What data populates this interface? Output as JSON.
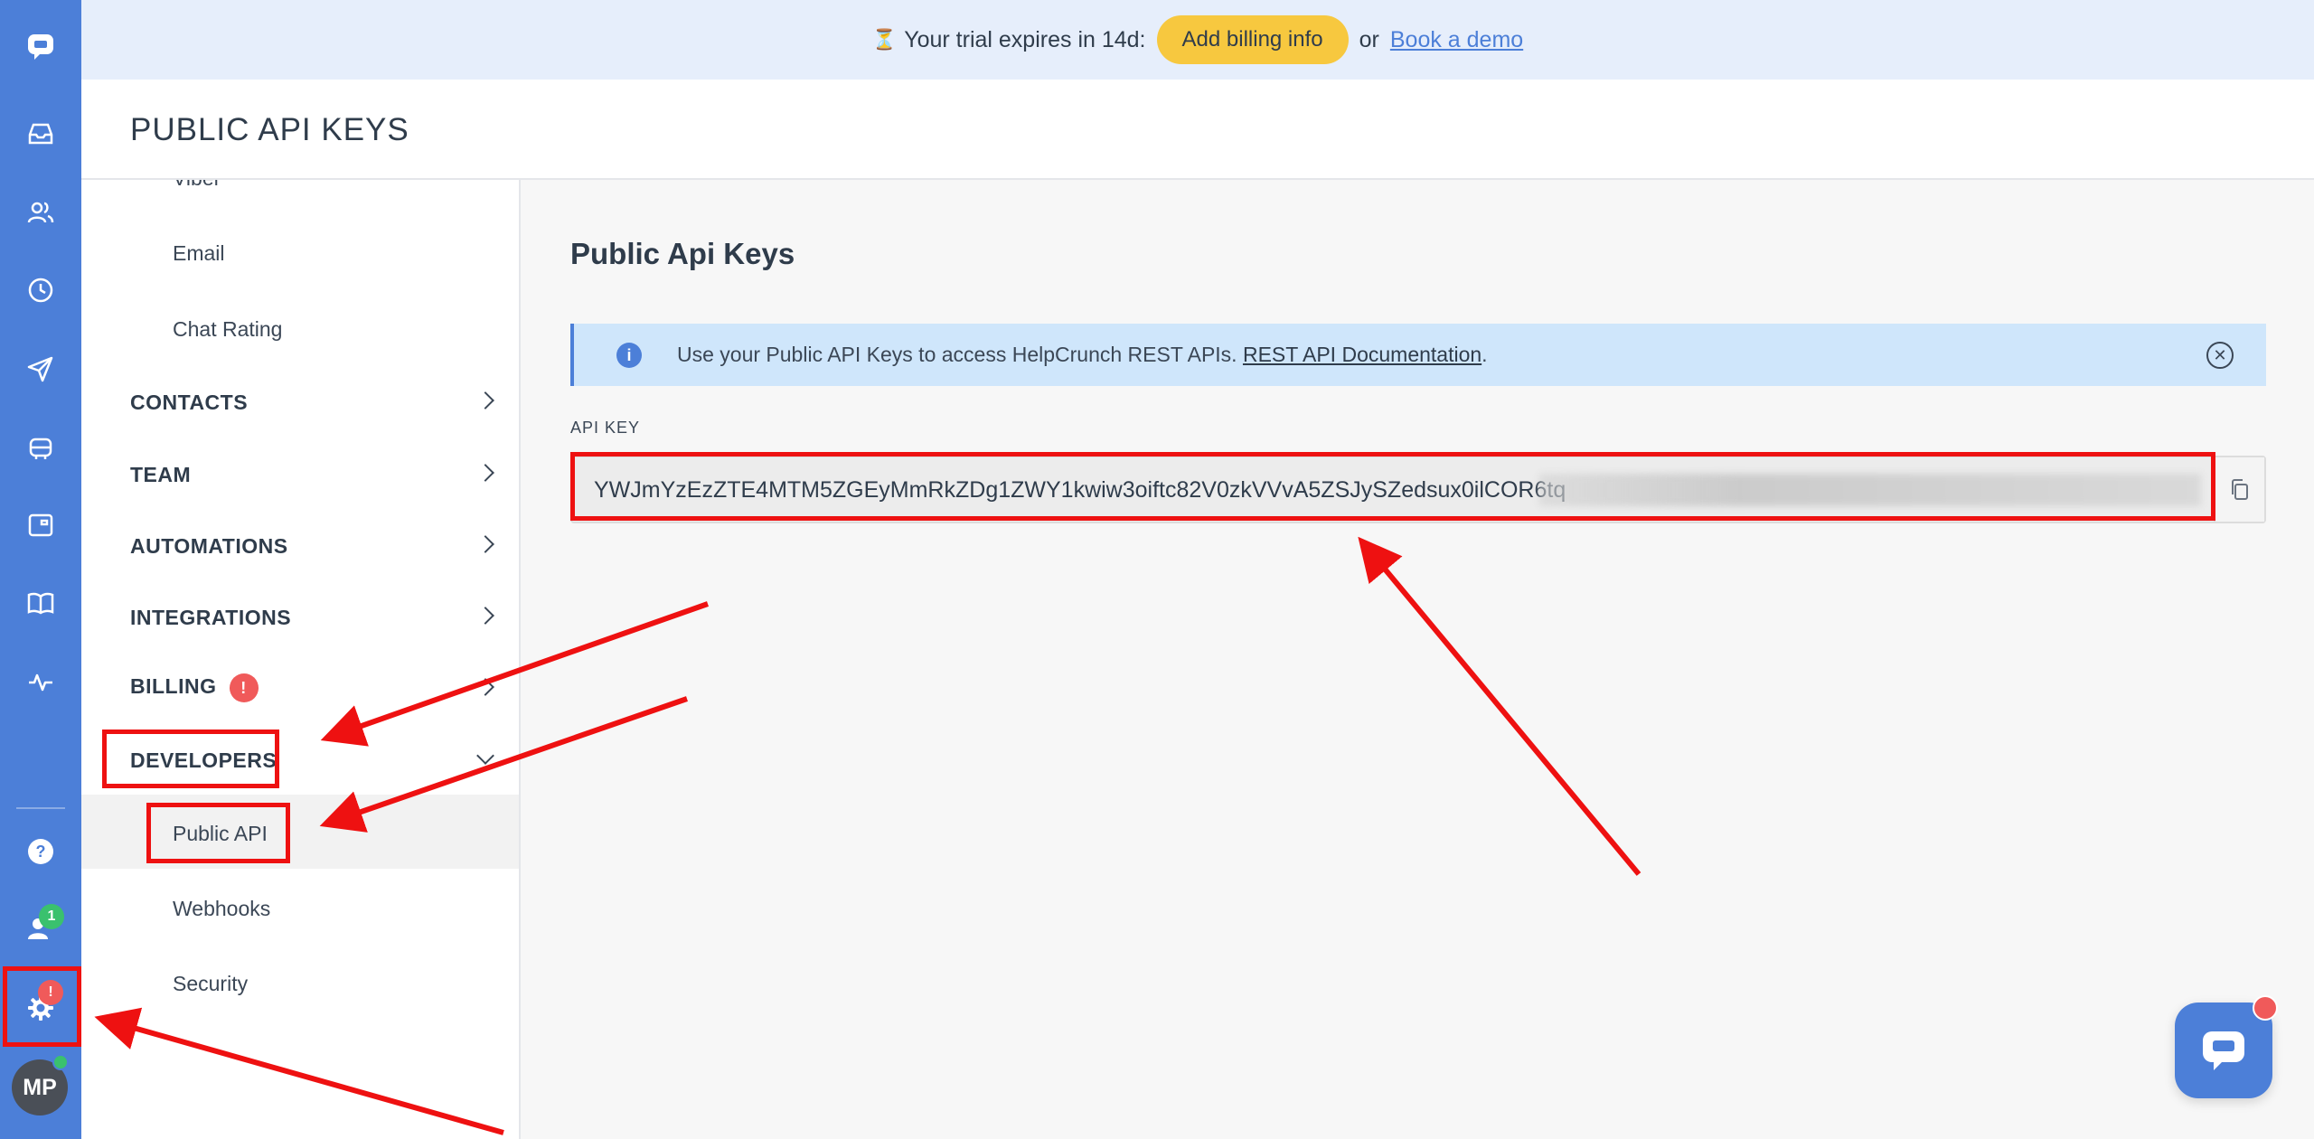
{
  "trial_bar": {
    "prefix": "Your trial expires in 14d:",
    "billing_button": "Add billing info",
    "or_text": "or",
    "demo_link": "Book a demo"
  },
  "page_title": "PUBLIC API KEYS",
  "settings_nav": {
    "sub_items_top": [
      "Viber",
      "Email",
      "Chat Rating"
    ],
    "sections": [
      {
        "label": "CONTACTS",
        "expanded": false
      },
      {
        "label": "TEAM",
        "expanded": false
      },
      {
        "label": "AUTOMATIONS",
        "expanded": false
      },
      {
        "label": "INTEGRATIONS",
        "expanded": false
      },
      {
        "label": "BILLING",
        "badge": "!",
        "expanded": false
      },
      {
        "label": "DEVELOPERS",
        "expanded": true
      }
    ],
    "developer_items": [
      "Public API",
      "Webhooks",
      "Security"
    ],
    "active_item": "Public API"
  },
  "content": {
    "title": "Public Api Keys",
    "info_text": "Use your Public API Keys to access HelpCrunch REST APIs.",
    "info_link": "REST API Documentation",
    "info_suffix": ".",
    "field_label": "API KEY",
    "api_key_visible": "YWJmYzEzZTE4MTM5ZGEyMmRkZDg1ZWY1kwiw3oiftc82V0zkVVvA5ZSJySZedsux0ilCOR6tq"
  },
  "rail": {
    "team_badge": "1",
    "settings_badge": "!",
    "avatar_initials": "MP",
    "icons": [
      "logo-chat-icon",
      "inbox-icon",
      "contacts-icon",
      "clock-icon",
      "send-icon",
      "bot-icon",
      "widget-icon",
      "book-icon",
      "activity-icon",
      "help-icon",
      "team-icon",
      "settings-gear-icon"
    ]
  },
  "colors": {
    "rail": "#4c7fd8",
    "trial_bar": "#e6eefb",
    "trial_button": "#f7c83f",
    "info_banner": "#cfe6fb",
    "badge_red": "#f05a5a",
    "annotation_red": "#ee1111",
    "online_green": "#3ac16e"
  }
}
